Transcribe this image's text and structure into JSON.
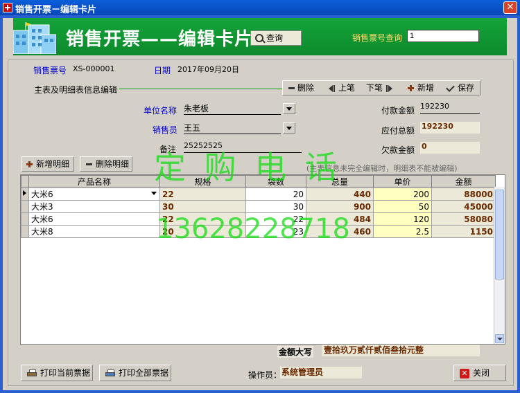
{
  "window": {
    "title": "销售开票－编辑卡片",
    "close_glyph": "✕"
  },
  "banner": {
    "title": "销售开票——编辑卡片",
    "query_button": "查询",
    "invoice_query_label": "销售票号查询",
    "invoice_query_value": "1"
  },
  "header": {
    "invoice_no_label": "销售票号",
    "invoice_no_value": "XS-000001",
    "date_label": "日期",
    "date_value": "2017年09月20日",
    "section_label": "主表及明细表信息编辑"
  },
  "toolbar": {
    "delete": "删除",
    "prev": "上笔",
    "next": "下笔",
    "add": "新增",
    "save": "保存"
  },
  "form": {
    "unit_label": "单位名称",
    "unit_value": "朱老板",
    "seller_label": "销售员",
    "seller_value": "王五",
    "note_label": "备注",
    "note_value": "25252525",
    "paid_label": "付款金额",
    "paid_value": "192230",
    "payable_label": "应付总额",
    "payable_value": "192230",
    "owed_label": "欠款金额",
    "owed_value": "0",
    "hint": "(主表信息未完全编辑时，明细表不能被编辑)"
  },
  "detail_buttons": {
    "add": "新增明细",
    "delete": "删除明细"
  },
  "table": {
    "columns": [
      "产品名称",
      "规格",
      "袋数",
      "总量",
      "单价",
      "金额"
    ],
    "rows": [
      {
        "name": "大米6",
        "spec": "22",
        "bags": "20",
        "total": "440",
        "price": "200",
        "amount": "88000"
      },
      {
        "name": "大米3",
        "spec": "30",
        "bags": "30",
        "total": "900",
        "price": "50",
        "amount": "45000"
      },
      {
        "name": "大米6",
        "spec": "22",
        "bags": "22",
        "total": "484",
        "price": "120",
        "amount": "58080"
      },
      {
        "name": "大米8",
        "spec": "20",
        "bags": "23",
        "total": "460",
        "price": "2.5",
        "amount": "1150"
      }
    ]
  },
  "watermark": {
    "line1": "定 购 电 话",
    "line2": "13628228718"
  },
  "footer": {
    "amount_words_label": "金额大写",
    "amount_words_value": "壹拾玖万贰仟贰佰叁拾元整",
    "print_current": "打印当前票据",
    "print_all": "打印全部票据",
    "operator_label": "操作员：",
    "operator_value": "系统管理员",
    "close": "关闭"
  },
  "colors": {
    "banner_green": "#14a43a",
    "label_blue": "#0000c8",
    "value_brown": "#6a2a00",
    "price_yellow": "#ffffc0",
    "watermark_green": "#14dc14"
  }
}
